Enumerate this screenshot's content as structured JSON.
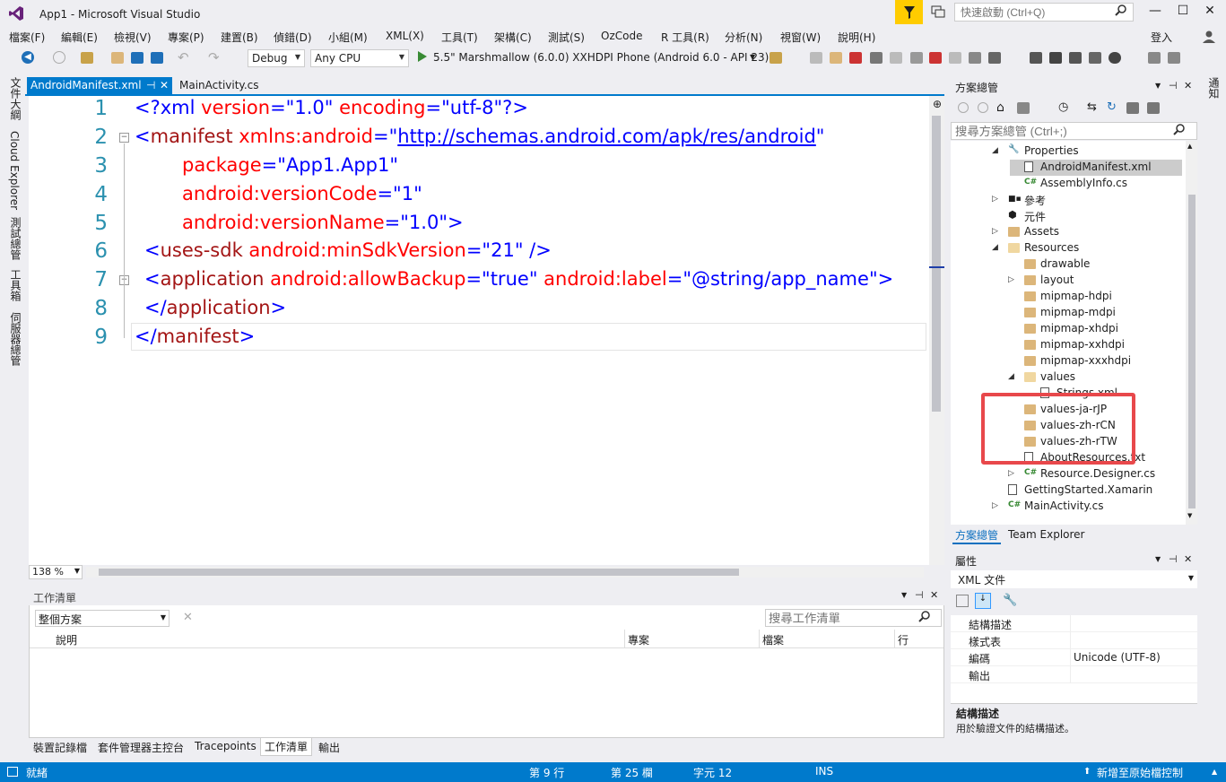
{
  "window": {
    "title": "App1 - Microsoft Visual Studio",
    "quick_launch_placeholder": "快速啟動 (Ctrl+Q)",
    "minimize": "—",
    "restore": "☐",
    "close": "✕",
    "login": "登入"
  },
  "menu": [
    "檔案(F)",
    "編輯(E)",
    "檢視(V)",
    "專案(P)",
    "建置(B)",
    "偵錯(D)",
    "小組(M)",
    "XML(X)",
    "工具(T)",
    "架構(C)",
    "測試(S)",
    "OzCode",
    "R 工具(R)",
    "分析(N)",
    "視窗(W)",
    "說明(H)"
  ],
  "toolbar": {
    "config": "Debug",
    "platform": "Any CPU",
    "run_target": "5.5\" Marshmallow (6.0.0) XXHDPI Phone (Android 6.0 - API 23)"
  },
  "left_strip": [
    "文件大綱",
    "Cloud Explorer",
    "測試總管",
    "工具箱",
    "伺服器總管"
  ],
  "right_strip": "通知",
  "editor": {
    "tabs": [
      {
        "label": "AndroidManifest.xml",
        "active": true
      },
      {
        "label": "MainActivity.cs",
        "active": false
      }
    ],
    "zoom": "138 %",
    "line_numbers": [
      "1",
      "2",
      "3",
      "4",
      "5",
      "6",
      "7",
      "8",
      "9"
    ],
    "code": {
      "l1": {
        "a": "<?xml ",
        "b": "version",
        "c": "=\"",
        "d": "1.0",
        "e": "\" ",
        "f": "encoding",
        "g": "=\"",
        "h": "utf-8",
        "i": "\"?>"
      },
      "l2": {
        "a": "<",
        "b": "manifest",
        "c": " xmlns:android",
        "d": "=\"",
        "e": "http://schemas.android.com/apk/res/android",
        "f": "\""
      },
      "l3": {
        "a": "package",
        "b": "=\"",
        "c": "App1.App1",
        "d": "\""
      },
      "l4": {
        "a": "android:versionCode",
        "b": "=\"",
        "c": "1",
        "d": "\""
      },
      "l5": {
        "a": "android:versionName",
        "b": "=\"",
        "c": "1.0",
        "d": "\">"
      },
      "l6": {
        "a": "<",
        "b": "uses-sdk",
        "c": " android:minSdkVersion",
        "d": "=\"",
        "e": "21",
        "f": "\" />"
      },
      "l7": {
        "a": "<",
        "b": "application",
        "c": " android:allowBackup",
        "d": "=\"",
        "e": "true",
        "f": "\" ",
        "g": "android:label",
        "h": "=\"",
        "i": "@string/app_name",
        "j": "\">"
      },
      "l8": {
        "a": "</",
        "b": "application",
        "c": ">"
      },
      "l9": {
        "a": "</",
        "b": "manifest",
        "c": ">"
      }
    }
  },
  "task_list": {
    "title": "工作清單",
    "scope": "整個方案",
    "search_placeholder": "搜尋工作清單",
    "columns": [
      "說明",
      "專案",
      "檔案",
      "行"
    ]
  },
  "bottom_tabs": [
    "裝置記錄檔",
    "套件管理器主控台",
    "Tracepoints",
    "工作清單",
    "輸出"
  ],
  "status": {
    "ready": "就緒",
    "line": "第 9 行",
    "col": "第 25 欄",
    "char": "字元 12",
    "ins": "INS",
    "source_control": "新增至原始檔控制"
  },
  "solution_explorer": {
    "title": "方案總管",
    "search_placeholder": "搜尋方案總管 (Ctrl+;)",
    "nodes": [
      {
        "label": "Properties",
        "depth": 1,
        "arrow": "◢",
        "icon": "wrench"
      },
      {
        "label": "AndroidManifest.xml",
        "depth": 2,
        "arrow": "",
        "icon": "xml",
        "selected": true
      },
      {
        "label": "AssemblyInfo.cs",
        "depth": 2,
        "arrow": "",
        "icon": "cs"
      },
      {
        "label": "參考",
        "depth": 1,
        "arrow": "▷",
        "icon": "ref"
      },
      {
        "label": "元件",
        "depth": 1,
        "arrow": "",
        "icon": "component"
      },
      {
        "label": "Assets",
        "depth": 1,
        "arrow": "▷",
        "icon": "folder"
      },
      {
        "label": "Resources",
        "depth": 1,
        "arrow": "◢",
        "icon": "folder-open"
      },
      {
        "label": "drawable",
        "depth": 2,
        "arrow": "",
        "icon": "folder"
      },
      {
        "label": "layout",
        "depth": 2,
        "arrow": "▷",
        "icon": "folder"
      },
      {
        "label": "mipmap-hdpi",
        "depth": 2,
        "arrow": "",
        "icon": "folder"
      },
      {
        "label": "mipmap-mdpi",
        "depth": 2,
        "arrow": "",
        "icon": "folder"
      },
      {
        "label": "mipmap-xhdpi",
        "depth": 2,
        "arrow": "",
        "icon": "folder"
      },
      {
        "label": "mipmap-xxhdpi",
        "depth": 2,
        "arrow": "",
        "icon": "folder"
      },
      {
        "label": "mipmap-xxxhdpi",
        "depth": 2,
        "arrow": "",
        "icon": "folder"
      },
      {
        "label": "values",
        "depth": 2,
        "arrow": "◢",
        "icon": "folder-open"
      },
      {
        "label": "Strings.xml",
        "depth": 3,
        "arrow": "",
        "icon": "xml"
      },
      {
        "label": "values-ja-rJP",
        "depth": 2,
        "arrow": "",
        "icon": "folder"
      },
      {
        "label": "values-zh-rCN",
        "depth": 2,
        "arrow": "",
        "icon": "folder"
      },
      {
        "label": "values-zh-rTW",
        "depth": 2,
        "arrow": "",
        "icon": "folder"
      },
      {
        "label": "AboutResources.txt",
        "depth": 2,
        "arrow": "",
        "icon": "txt"
      },
      {
        "label": "Resource.Designer.cs",
        "depth": 2,
        "arrow": "▷",
        "icon": "cs"
      },
      {
        "label": "GettingStarted.Xamarin",
        "depth": 1,
        "arrow": "",
        "icon": "file"
      },
      {
        "label": "MainActivity.cs",
        "depth": 1,
        "arrow": "▷",
        "icon": "cs"
      }
    ],
    "tabs": [
      "方案總管",
      "Team Explorer"
    ]
  },
  "properties": {
    "title": "屬性",
    "object": "XML 文件",
    "rows": [
      {
        "name": "結構描述",
        "value": ""
      },
      {
        "name": "樣式表",
        "value": ""
      },
      {
        "name": "編碼",
        "value": "Unicode (UTF-8)"
      },
      {
        "name": "輸出",
        "value": ""
      }
    ],
    "desc_title": "結構描述",
    "desc_text": "用於驗證文件的結構描述。"
  },
  "colors": {
    "accent": "#007acc",
    "highlight_box": "#e8484b",
    "folder": "#dcb67a"
  }
}
